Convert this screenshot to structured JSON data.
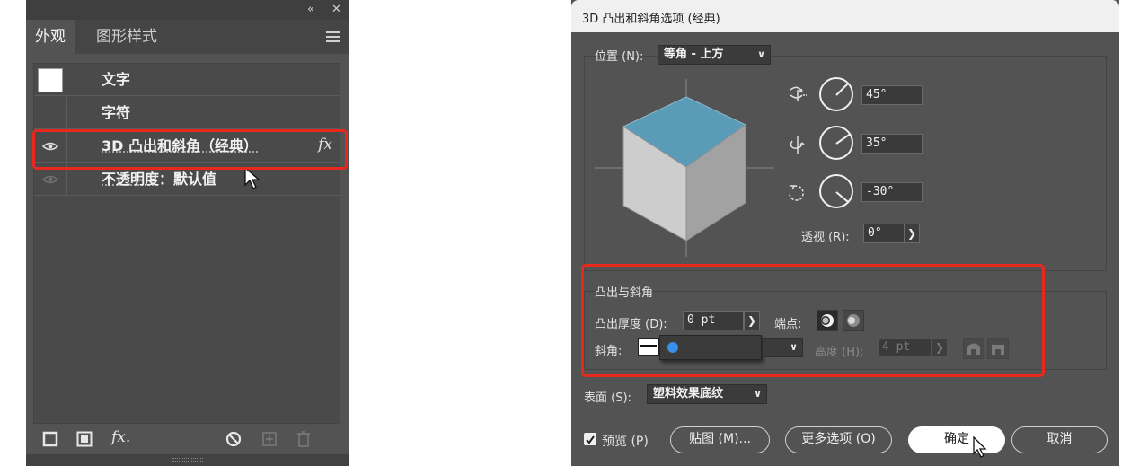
{
  "appearance_panel": {
    "tabs": [
      "外观",
      "图形样式"
    ],
    "rows": {
      "object": "文字",
      "char": "字符",
      "effect": "3D 凸出和斜角（经典）",
      "opacity_label": "不透明度",
      "opacity_value": "：默认值"
    },
    "fx_label": "fx",
    "bottom_fx": "fx."
  },
  "dialog": {
    "title": "3D 凸出和斜角选项 (经典)",
    "position_label": "位置 (N):",
    "position_value": "等角 - 上方",
    "rotate_x": "45°",
    "rotate_y": "35°",
    "rotate_z": "-30°",
    "perspective_label": "透视 (R):",
    "perspective_value": "0°",
    "extrude_section": "凸出与斜角",
    "extrude_depth_label": "凸出厚度 (D):",
    "extrude_depth_value": "0 pt",
    "cap_label": "端点:",
    "bevel_label": "斜角:",
    "height_label": "高度 (H):",
    "height_value": "4 pt",
    "surface_label": "表面 (S):",
    "surface_value": "塑料效果底纹",
    "preview_label": "预览 (P)",
    "map_button": "贴图 (M)...",
    "more_button": "更多选项 (O)",
    "ok_button": "确定",
    "cancel_button": "取消"
  },
  "colors": {
    "panel_bg": "#535353",
    "highlight_red": "#e8281e",
    "cube_top": "#5a9bb8",
    "slider_blue": "#3a8fe8"
  }
}
